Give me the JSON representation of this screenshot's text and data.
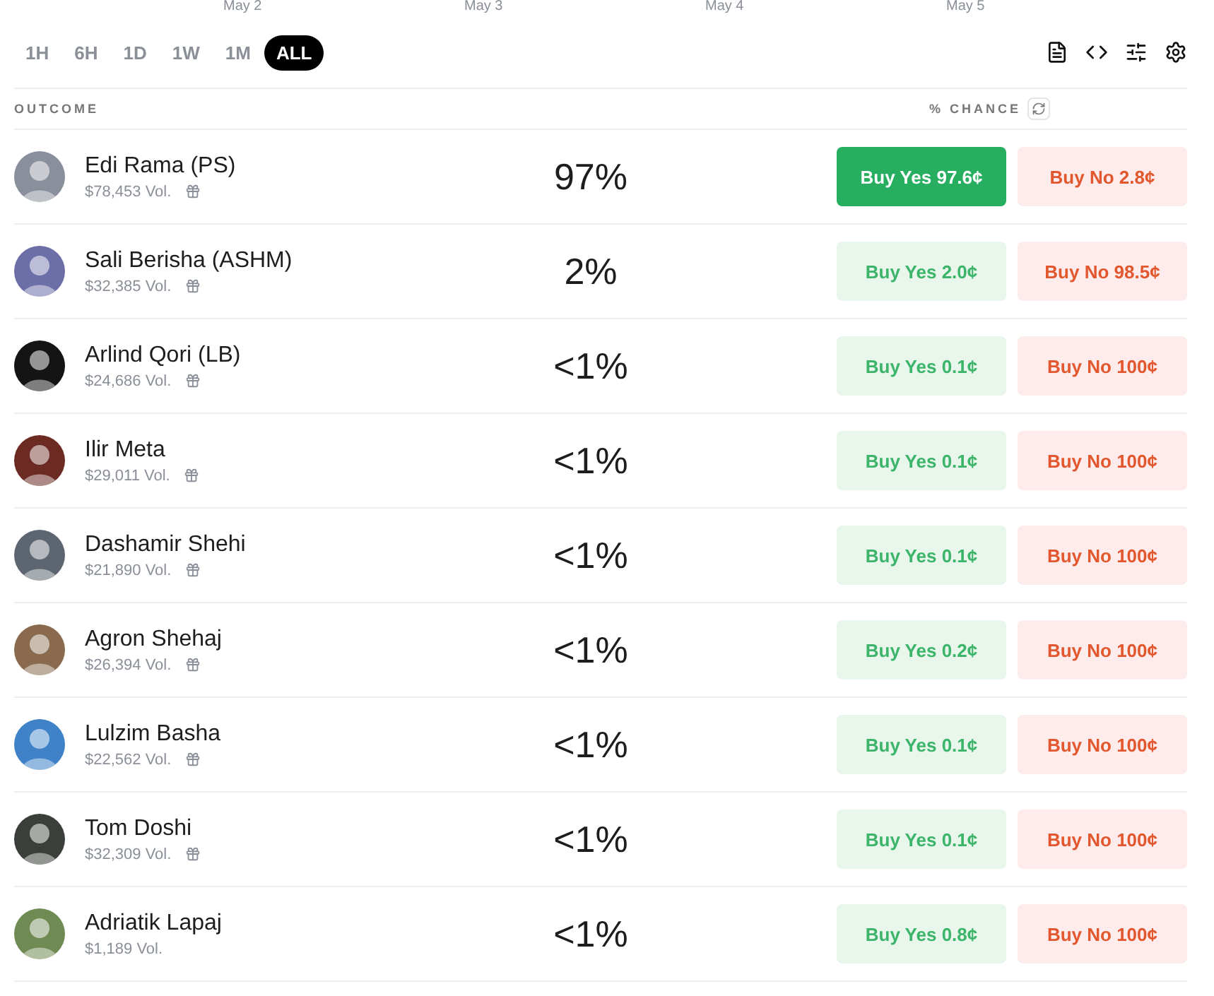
{
  "axis_labels": [
    "May 2",
    "May 3",
    "May 4",
    "May 5"
  ],
  "time_ranges": [
    {
      "label": "1H",
      "selected": false
    },
    {
      "label": "6H",
      "selected": false
    },
    {
      "label": "1D",
      "selected": false
    },
    {
      "label": "1W",
      "selected": false
    },
    {
      "label": "1M",
      "selected": false
    },
    {
      "label": "ALL",
      "selected": true
    }
  ],
  "table": {
    "columns": [
      "OUTCOME",
      "% CHANCE"
    ],
    "rows": [
      {
        "name": "Edi Rama (PS)",
        "volume": "$78,453 Vol.",
        "gift": true,
        "chance": "97%",
        "yes": "Buy Yes 97.6¢",
        "no": "Buy No 2.8¢",
        "yes_emphasized": true,
        "color": "#8a8f9c"
      },
      {
        "name": "Sali Berisha (ASHM)",
        "volume": "$32,385 Vol.",
        "gift": true,
        "chance": "2%",
        "yes": "Buy Yes 2.0¢",
        "no": "Buy No 98.5¢",
        "yes_emphasized": false,
        "color": "#6c6ea8"
      },
      {
        "name": "Arlind Qori (LB)",
        "volume": "$24,686 Vol.",
        "gift": true,
        "chance": "<1%",
        "yes": "Buy Yes 0.1¢",
        "no": "Buy No 100¢",
        "yes_emphasized": false,
        "color": "#141414"
      },
      {
        "name": "Ilir Meta",
        "volume": "$29,011 Vol.",
        "gift": true,
        "chance": "<1%",
        "yes": "Buy Yes 0.1¢",
        "no": "Buy No 100¢",
        "yes_emphasized": false,
        "color": "#6b2a22"
      },
      {
        "name": "Dashamir Shehi",
        "volume": "$21,890 Vol.",
        "gift": true,
        "chance": "<1%",
        "yes": "Buy Yes 0.1¢",
        "no": "Buy No 100¢",
        "yes_emphasized": false,
        "color": "#5d6670"
      },
      {
        "name": "Agron Shehaj",
        "volume": "$26,394 Vol.",
        "gift": true,
        "chance": "<1%",
        "yes": "Buy Yes 0.2¢",
        "no": "Buy No 100¢",
        "yes_emphasized": false,
        "color": "#8a6a4e"
      },
      {
        "name": "Lulzim Basha",
        "volume": "$22,562 Vol.",
        "gift": true,
        "chance": "<1%",
        "yes": "Buy Yes 0.1¢",
        "no": "Buy No 100¢",
        "yes_emphasized": false,
        "color": "#3f82c8"
      },
      {
        "name": "Tom Doshi",
        "volume": "$32,309 Vol.",
        "gift": true,
        "chance": "<1%",
        "yes": "Buy Yes 0.1¢",
        "no": "Buy No 100¢",
        "yes_emphasized": false,
        "color": "#3a3f3a"
      },
      {
        "name": "Adriatik Lapaj",
        "volume": "$1,189 Vol.",
        "gift": false,
        "chance": "<1%",
        "yes": "Buy Yes 0.8¢",
        "no": "Buy No 100¢",
        "yes_emphasized": false,
        "color": "#6f8a52"
      }
    ]
  }
}
